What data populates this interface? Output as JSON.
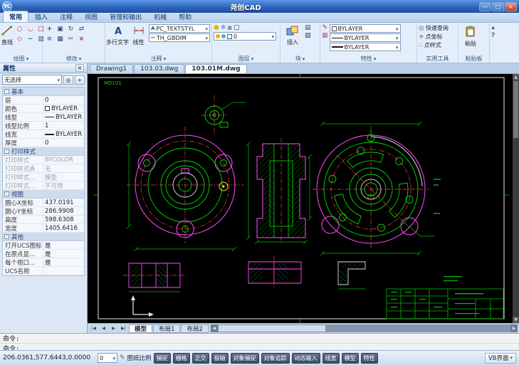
{
  "window": {
    "logo": "YC",
    "title": "尧创CAD"
  },
  "menu": {
    "tabs": [
      "常用",
      "插入",
      "注释",
      "视图",
      "管理和输出",
      "机械",
      "帮助"
    ],
    "active_index": 0
  },
  "ribbon": {
    "draw": {
      "primary": "直线",
      "group": "绘图"
    },
    "modify": {
      "group": "修改"
    },
    "annotate": {
      "mtext": "多行文字",
      "dim": "线性",
      "text_style": "PC_TEXTSTYL",
      "dim_style": "TH_GBDIM",
      "group": "注释"
    },
    "layer": {
      "current": "0",
      "group": "图层"
    },
    "block": {
      "insert": "插入",
      "group": "块"
    },
    "properties": {
      "color": "BYLAYER",
      "linetype": "BYLAYER",
      "lineweight": "BYLAYER",
      "group": "特性"
    },
    "utilities": {
      "items": [
        "快速查询",
        "点坐标",
        "点样式"
      ],
      "group": "实用工具"
    },
    "clipboard": {
      "paste": "粘贴",
      "group": "粘贴板"
    }
  },
  "docs": {
    "tabs": [
      "Drawing1",
      "103.03.dwg",
      "103.01M.dwg"
    ],
    "active_index": 2
  },
  "panel": {
    "title": "属性",
    "selector": "无选择",
    "sections": [
      {
        "label": "基本",
        "rows": [
          {
            "k": "层",
            "v": "0"
          },
          {
            "k": "颜色",
            "v": "BYLAYER"
          },
          {
            "k": "线型",
            "v": "BYLAYER"
          },
          {
            "k": "线型比例",
            "v": "1"
          },
          {
            "k": "线宽",
            "v": "BYLAYER"
          },
          {
            "k": "厚度",
            "v": "0"
          }
        ]
      },
      {
        "label": "打印样式",
        "rows": [
          {
            "k": "打印样式",
            "v": "BYCOLOR"
          },
          {
            "k": "打印样式表",
            "v": "无"
          },
          {
            "k": "打印样式...",
            "v": "模型"
          },
          {
            "k": "打印样式...",
            "v": "不可用"
          }
        ]
      },
      {
        "label": "视图",
        "rows": [
          {
            "k": "圆心X坐标",
            "v": "437.0191"
          },
          {
            "k": "圆心Y坐标",
            "v": "286.9908"
          },
          {
            "k": "高度",
            "v": "598.6308"
          },
          {
            "k": "宽度",
            "v": "1405.6416"
          }
        ]
      },
      {
        "label": "其他",
        "rows": [
          {
            "k": "打开UCS图标",
            "v": "是"
          },
          {
            "k": "在原点显...",
            "v": "是"
          },
          {
            "k": "每个视口...",
            "v": "是"
          },
          {
            "k": "UCS名称",
            "v": ""
          }
        ]
      }
    ]
  },
  "canvas": {
    "frame_label": "MD101"
  },
  "model_tabs": {
    "tabs": [
      "模型",
      "布局1",
      "布局2"
    ],
    "active_index": 0
  },
  "command": {
    "line1": "命令:",
    "line2": "命令:"
  },
  "status": {
    "coords": "206.0361,577.6443,0.0000",
    "scale_value": "0",
    "scale_label": "图纸比例",
    "toggles": [
      "捕捉",
      "栅格",
      "正交",
      "极轴",
      "对象捕捉",
      "对象追踪",
      "动态输入",
      "线宽",
      "模型",
      "特性"
    ],
    "ui_mode": "VB界面"
  }
}
